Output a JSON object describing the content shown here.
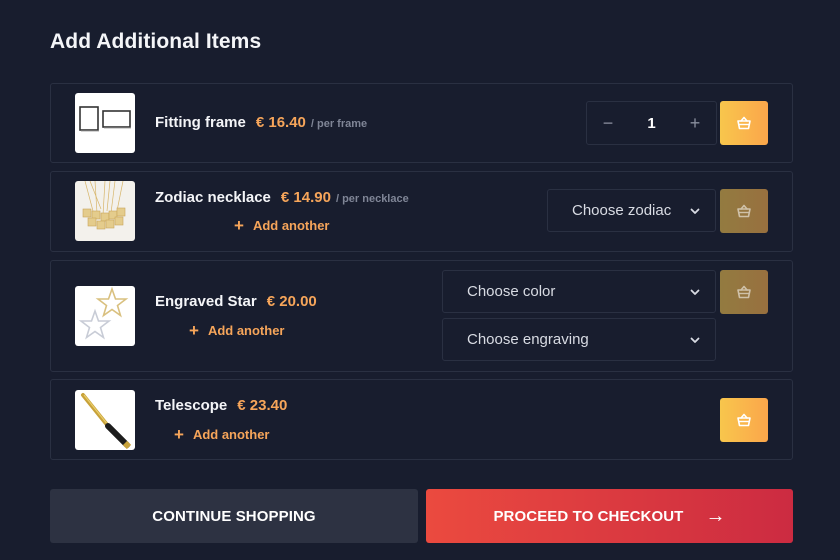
{
  "page": {
    "title": "Add Additional Items"
  },
  "items": [
    {
      "name": "Fitting frame",
      "price": "€ 16.40",
      "per_unit": "/ per frame",
      "image": "frame-image",
      "quantity": "1",
      "decrement_label": "−",
      "increment_label": "+",
      "cart_enabled": true
    },
    {
      "name": "Zodiac necklace",
      "price": "€ 14.90",
      "per_unit": "/ per necklace",
      "image": "necklace-image",
      "add_another": "Add another",
      "add_icon": "+",
      "select_zodiac": "Choose zodiac",
      "cart_enabled": false
    },
    {
      "name": "Engraved Star",
      "price": "€ 20.00",
      "image": "star-image",
      "add_another": "Add another",
      "add_icon": "+",
      "select_color": "Choose color",
      "select_engraving": "Choose engraving",
      "cart_enabled": false
    },
    {
      "name": "Telescope",
      "price": "€ 23.40",
      "image": "telescope-image",
      "add_another": "Add another",
      "add_icon": "+",
      "cart_enabled": true
    }
  ],
  "actions": {
    "continue_label": "CONTINUE SHOPPING",
    "checkout_label": "PROCEED TO CHECKOUT",
    "checkout_arrow": "→"
  },
  "colors": {
    "background": "#181d2e",
    "accent_orange": "#f6a55a",
    "cart_gradient_start": "#f8c64c",
    "cart_gradient_end": "#fba64b",
    "checkout_gradient_start": "#eb4a3f",
    "checkout_gradient_end": "#cc2b41",
    "continue_bg": "#2d3242"
  }
}
